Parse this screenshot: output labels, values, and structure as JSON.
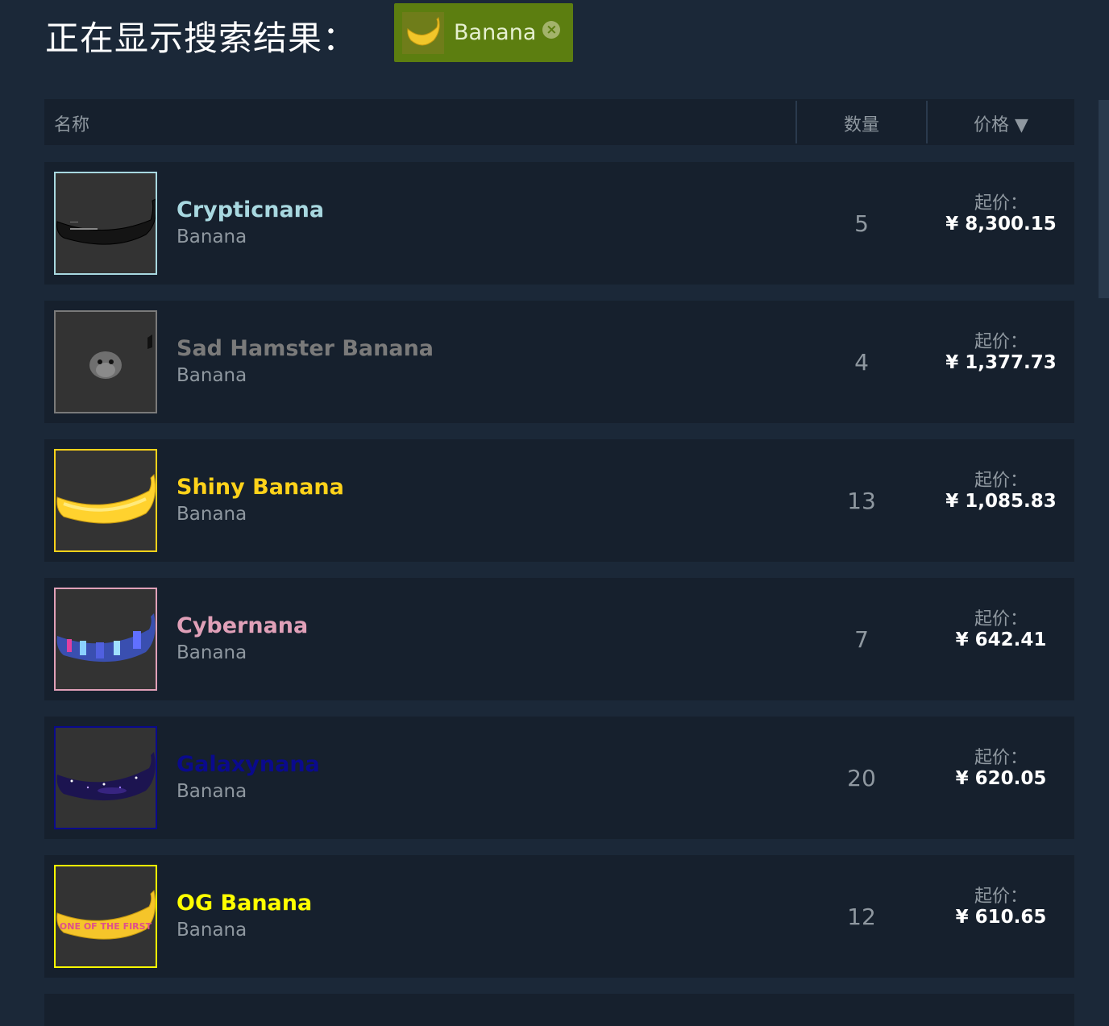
{
  "heading": "正在显示搜索结果：",
  "filter": {
    "label": "Banana",
    "thumb_icon": "banana-icon",
    "close_icon": "close-circle-icon"
  },
  "table": {
    "col_name": "名称",
    "col_quantity": "数量",
    "col_price": "价格 ▼"
  },
  "items": [
    {
      "name": "Crypticnana",
      "game": "Banana",
      "quantity": "5",
      "price_label": "起价：",
      "price": "¥ 8,300.15",
      "name_color": "#a8d8e0",
      "border_color": "#a8d8e0",
      "icon": "black-banana-icon"
    },
    {
      "name": "Sad Hamster Banana",
      "game": "Banana",
      "quantity": "4",
      "price_label": "起价：",
      "price": "¥ 1,377.73",
      "name_color": "#7a7a7a",
      "border_color": "#7a7a7a",
      "icon": "hamster-banana-icon"
    },
    {
      "name": "Shiny Banana",
      "game": "Banana",
      "quantity": "13",
      "price_label": "起价：",
      "price": "¥ 1,085.83",
      "name_color": "#ffd21a",
      "border_color": "#ffd21a",
      "icon": "yellow-banana-icon"
    },
    {
      "name": "Cybernana",
      "game": "Banana",
      "quantity": "7",
      "price_label": "起价：",
      "price": "¥ 642.41",
      "name_color": "#e0a0b8",
      "border_color": "#e0a0b8",
      "icon": "cyber-banana-icon"
    },
    {
      "name": "Galaxynana",
      "game": "Banana",
      "quantity": "20",
      "price_label": "起价：",
      "price": "¥ 620.05",
      "name_color": "#0a0a8c",
      "border_color": "#0a0a8c",
      "icon": "galaxy-banana-icon"
    },
    {
      "name": "OG Banana",
      "game": "Banana",
      "quantity": "12",
      "price_label": "起价：",
      "price": "¥ 610.65",
      "name_color": "#ffff00",
      "border_color": "#ffff00",
      "icon": "og-banana-icon",
      "overlay_text": "ONE OF THE FIRST"
    }
  ]
}
